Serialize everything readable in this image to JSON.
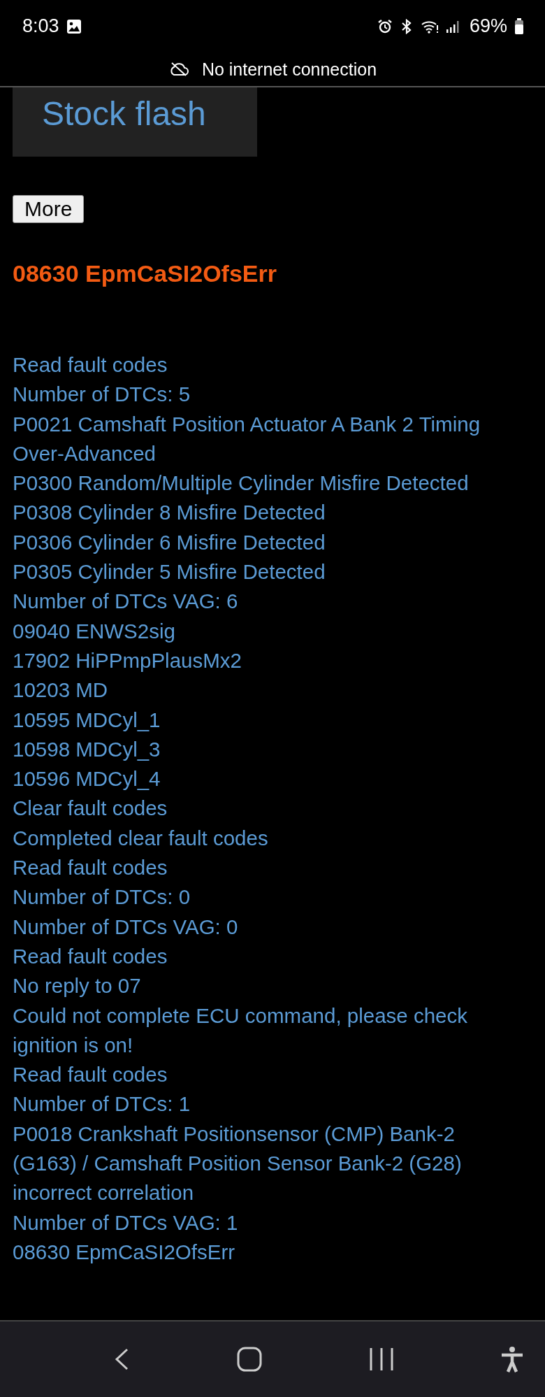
{
  "status_bar": {
    "time": "8:03",
    "battery": "69%"
  },
  "banner": {
    "text": "No internet connection"
  },
  "stock_flash": {
    "label": "Stock flash"
  },
  "more_button": {
    "label": "More"
  },
  "heading": "08630 EpmCaSI2OfsErr",
  "log": [
    "Read fault codes",
    "Number of DTCs: 5",
    "P0021 Camshaft Position Actuator A Bank 2 Timing Over-Advanced",
    "P0300 Random/Multiple Cylinder Misfire Detected",
    "P0308 Cylinder 8 Misfire Detected",
    "P0306 Cylinder 6 Misfire Detected",
    "P0305 Cylinder 5 Misfire Detected",
    "Number of DTCs VAG: 6",
    "09040 ENWS2sig",
    "17902 HiPPmpPlausMx2",
    "10203 MD",
    "10595 MDCyl_1",
    "10598 MDCyl_3",
    "10596 MDCyl_4",
    "Clear fault codes",
    "Completed clear fault codes",
    "Read fault codes",
    "Number of DTCs: 0",
    "Number of DTCs VAG: 0",
    "Read fault codes",
    "No reply to 07",
    "Could not complete ECU command, please check ignition is on!",
    "Read fault codes",
    "Number of DTCs: 1",
    "P0018 Crankshaft Positionsensor (CMP) Bank-2 (G163) / Camshaft Position Sensor Bank-2 (G28) incorrect correlation",
    "Number of DTCs VAG: 1",
    "08630 EpmCaSI2OfsErr"
  ]
}
